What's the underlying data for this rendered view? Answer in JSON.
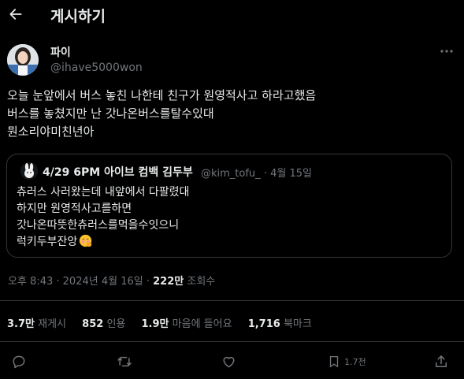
{
  "header": {
    "title": "게시하기"
  },
  "post": {
    "author_name": "파이",
    "author_handle": "@ihave5000won",
    "text": "오늘 눈앞에서 버스 놓친 나한테 친구가 원영적사고 하라고했음\n버스를 놓쳤지만 난 갓나온버스를탈수있대\n뭔소리야미친년아"
  },
  "quote": {
    "author_name": "4/29 6PM 아이브 컴백 김두부",
    "author_handle": "@kim_tofu_",
    "date": "4월 15일",
    "text": "츄러스 사러왔는데 내앞에서 다팔렸대\n하지만 원영적사고를하면\n갓나온따뜻한츄러스를먹을수잇으니\n럭키두부잔앙"
  },
  "meta": {
    "time": "오후 8:43",
    "date": "2024년 4월 16일",
    "views": "222만",
    "views_label": "조회수"
  },
  "stats": {
    "reposts": "3.7만",
    "reposts_label": "재게시",
    "quotes": "852",
    "quotes_label": "인용",
    "likes": "1.9만",
    "likes_label": "마음에 들어요",
    "bookmarks": "1,716",
    "bookmarks_label": "북마크"
  },
  "actions": {
    "bookmark_count": "1.7천"
  },
  "icons": [
    "back-arrow-icon",
    "more-icon",
    "reply-icon",
    "repost-icon",
    "like-icon",
    "bookmark-icon",
    "share-icon",
    "blushing-emoji-icon"
  ],
  "colors": {
    "background": "#000000",
    "text": "#e7e9ea",
    "muted": "#71767b",
    "border": "#2f3336"
  }
}
